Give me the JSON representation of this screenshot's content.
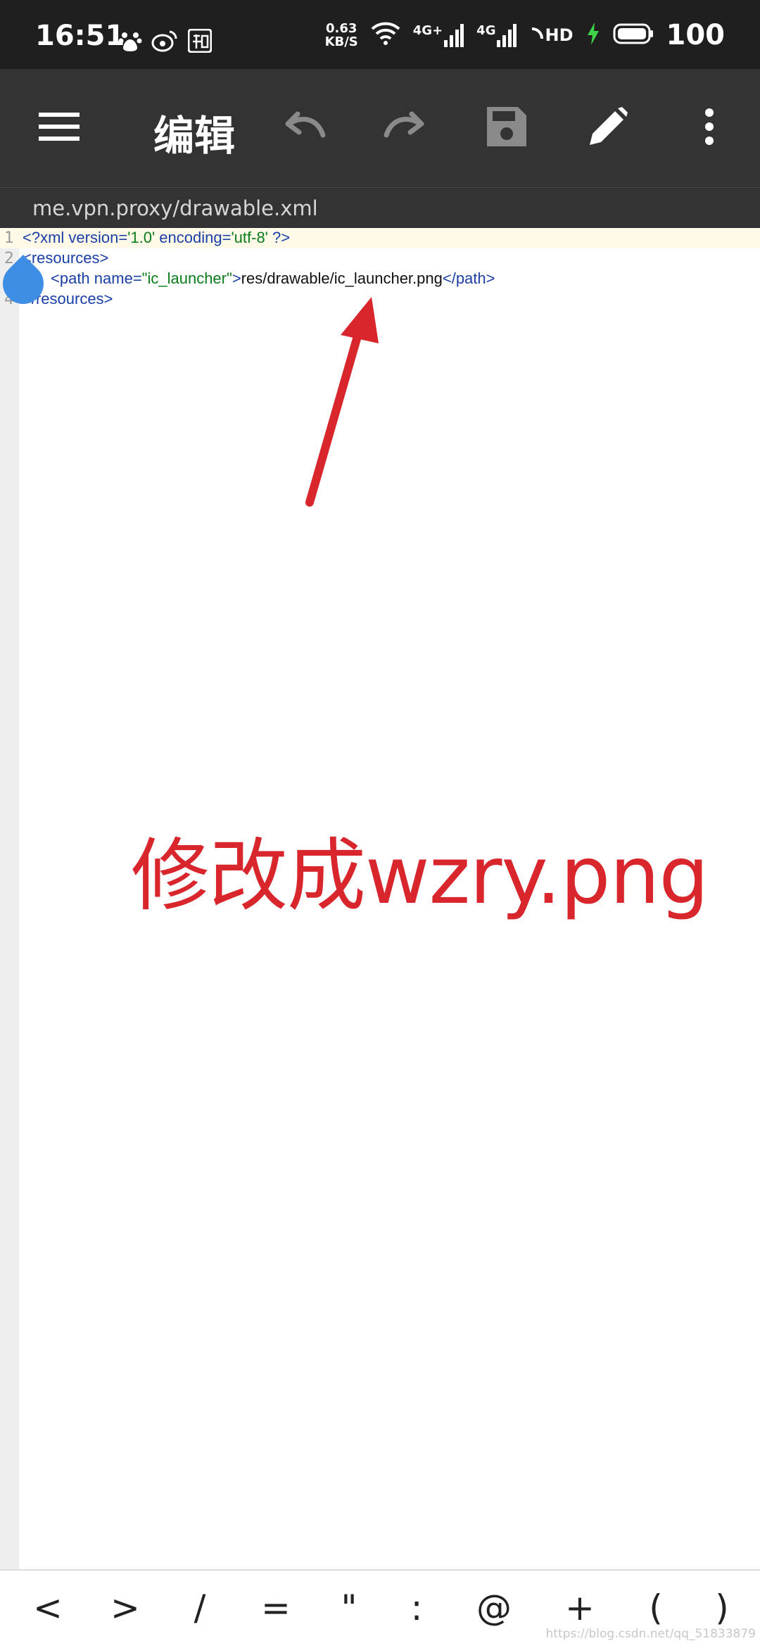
{
  "status_bar": {
    "time": "16:51",
    "net_speed_value": "0.63",
    "net_speed_unit": "KB/S",
    "signal1_tag": "4G+",
    "signal2_tag": "4G",
    "hd_tag": "HD",
    "battery": "100"
  },
  "toolbar": {
    "title": "编辑"
  },
  "path": "me.vpn.proxy/drawable.xml",
  "editor": {
    "lines": [
      {
        "no": "1"
      },
      {
        "no": "2"
      },
      {
        "no": "3"
      },
      {
        "no": "4"
      }
    ],
    "l1": {
      "a": "<?xml ",
      "b": "version=",
      "c": "'1.0'",
      "d": " encoding=",
      "e": "'utf-8'",
      "f": " ?>"
    },
    "l2": {
      "a": "<resources>"
    },
    "l3": {
      "a": "<path ",
      "b": "name=",
      "c": "\"ic_launcher\"",
      "d": ">",
      "e": "res/drawable/ic_launcher.png",
      "f": "</path>"
    },
    "l4": {
      "a": "</resources>"
    }
  },
  "annotation": "修改成wzry.png",
  "symbol_bar": [
    "<",
    ">",
    "/",
    "=",
    "\"",
    ":",
    "@",
    "+",
    "(",
    ")"
  ],
  "watermark": "https://blog.csdn.net/qq_51833879",
  "colors": {
    "toolbar_bg": "#333333",
    "status_bg": "#1f1f1f",
    "annotation_red": "#d8262c",
    "cursor_blue": "#3f8ee6"
  }
}
